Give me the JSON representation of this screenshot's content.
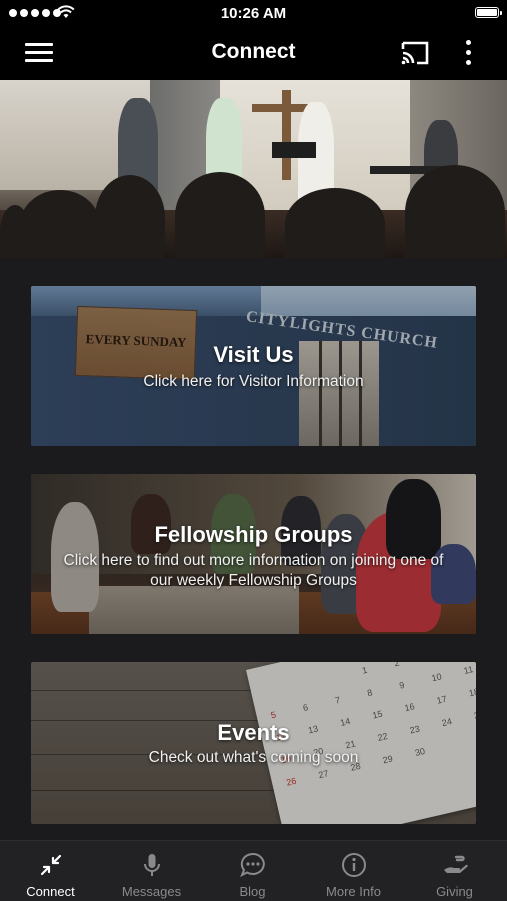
{
  "status_bar": {
    "time": "10:26 AM"
  },
  "app_bar": {
    "title": "Connect"
  },
  "cards": {
    "visit": {
      "title": "Visit Us",
      "subtitle": "Click here for Visitor Information",
      "sign_text": "EVERY  SUNDAY",
      "building_sign": "CITYLIGHTS CHURCH"
    },
    "fellowship": {
      "title": "Fellowship Groups",
      "subtitle": "Click here to find out more information on joining one of our weekly Fellowship Groups"
    },
    "events": {
      "title": "Events",
      "subtitle": "Check out what's coming soon"
    }
  },
  "tabs": [
    {
      "label": "Connect",
      "icon": "compress-arrows-icon",
      "active": true
    },
    {
      "label": "Messages",
      "icon": "microphone-icon",
      "active": false
    },
    {
      "label": "Blog",
      "icon": "chat-bubble-icon",
      "active": false
    },
    {
      "label": "More Info",
      "icon": "info-circle-icon",
      "active": false
    },
    {
      "label": "Giving",
      "icon": "giving-hand-icon",
      "active": false
    }
  ],
  "colors": {
    "background": "#1b1b1d",
    "bar": "#000000",
    "tab_bar": "#222224",
    "tab_active": "#ffffff",
    "tab_inactive": "#8a8a8c"
  }
}
